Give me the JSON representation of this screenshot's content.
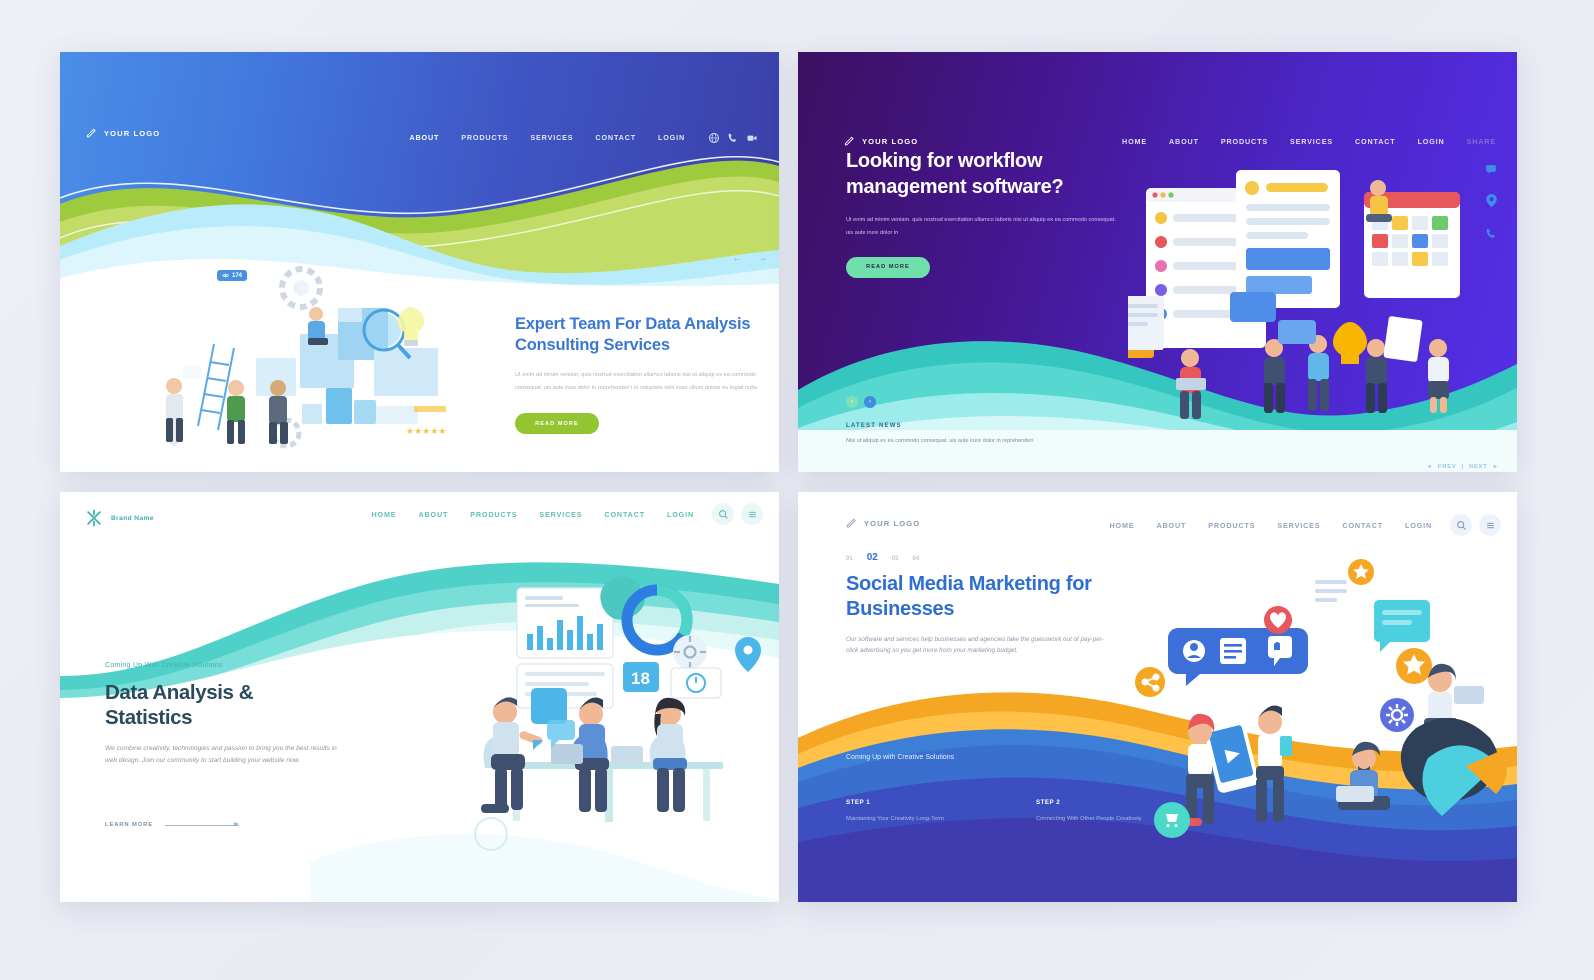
{
  "panels": [
    {
      "id": "panel-data-analysis",
      "logo": "YOUR LOGO",
      "nav": [
        "ABOUT",
        "PRODUCTS",
        "SERVICES",
        "CONTACT",
        "LOGIN"
      ],
      "nav_active": "ABOUT",
      "icons": [
        "globe-icon",
        "phone-icon",
        "video-icon"
      ],
      "heading": "Expert Team For Data Analysis Consulting Services",
      "body": "Ut enim ad minim veniam, quis nostrud exercitation ullamco laboris nisi ut aliquip ex ea commodo consequat. uis aute irure dolor in reprehenderi t in voluptate velit esse cillum dolore eu fugiat nulla",
      "button": "READ MORE",
      "views_badge": "174",
      "arrows": [
        "←",
        "→"
      ],
      "accent": "#3a78d4",
      "button_color": "#93c431"
    },
    {
      "id": "panel-workflow",
      "logo": "YOUR LOGO",
      "nav": [
        "HOME",
        "ABOUT",
        "PRODUCTS",
        "SERVICES",
        "CONTACT",
        "LOGIN",
        "SHARE"
      ],
      "nav_active": "HOME",
      "heading": "Looking for workflow management software?",
      "body": "Ut enim ad minim veniam. quis nostrud exercitation ullamco laboris nisi ut aliquip ex ea commodo consequat. uis aute irure dolor in",
      "button": "READ MORE",
      "news_label": "LATEST NEWS",
      "news_body": "Nisi ut aliquip ex ea commodo consequat. uis aute irure dolor in reprehenderi",
      "pager": {
        "prev": "PREV",
        "sep": "|",
        "next": "NEXT"
      },
      "side_icons": [
        "chat-icon",
        "location-pin-icon",
        "phone-icon"
      ],
      "accent": "#5430e8",
      "button_color": "#6fe0a9"
    },
    {
      "id": "panel-statistics",
      "logo": "Brand Name",
      "nav": [
        "HOME",
        "ABOUT",
        "PRODUCTS",
        "SERVICES",
        "CONTACT",
        "LOGIN"
      ],
      "icons": [
        "search-icon",
        "hamburger-menu-icon"
      ],
      "kicker": "Coming Up With Creative Solutions",
      "heading": "Data Analysis & Statistics",
      "body": "We combine creativity, technologies and passion to bring you the best results in web design. Join our community to start building your website now.",
      "link": "LEARN MORE",
      "calendar_day": "18",
      "accent": "#3bb0aa"
    },
    {
      "id": "panel-social-media",
      "logo": "YOUR LOGO",
      "nav": [
        "HOME",
        "ABOUT",
        "PRODUCTS",
        "SERVICES",
        "CONTACT",
        "LOGIN"
      ],
      "icons": [
        "search-icon",
        "hamburger-menu-icon"
      ],
      "pagination": [
        "01",
        "02",
        "03",
        "04"
      ],
      "pagination_active": "02",
      "heading": "Social Media Marketing for Businesses",
      "body": "Our software and services help businesses and agencies take the guesswork out of pay-per-click advertising so you get more from your marketing budget.",
      "lower_kicker": "Coming Up with Creative Solutions",
      "steps": [
        {
          "title": "STEP 1",
          "text": "Maintaining Your Creativity Long-Term"
        },
        {
          "title": "STEP 2",
          "text": "Connecting With Other People Creatively"
        }
      ],
      "accent": "#2f6fd0"
    }
  ]
}
